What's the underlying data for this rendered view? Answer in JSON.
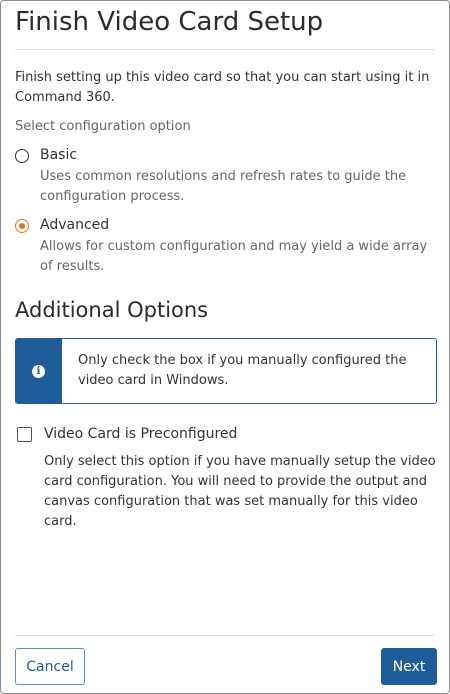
{
  "dialog": {
    "title": "Finish Video Card Setup",
    "intro": "Finish setting up this video card so that you can start using it in Command 360.",
    "config_label": "Select configuration option",
    "options": [
      {
        "label": "Basic",
        "description": "Uses common resolutions and refresh rates to guide the configuration process.",
        "selected": false
      },
      {
        "label": "Advanced",
        "description": "Allows for custom configuration and may yield a wide array of results.",
        "selected": true
      }
    ],
    "additional_heading": "Additional Options",
    "info_icon": "info-icon",
    "info_text": "Only check the box if you manually configured the video card in Windows.",
    "preconfigured": {
      "label": "Video Card is Preconfigured",
      "checked": false,
      "description": "Only select this option if you have manually setup the video card configuration. You will need to provide the output and canvas configuration that was set manually for this video card."
    },
    "buttons": {
      "cancel": "Cancel",
      "next": "Next"
    },
    "colors": {
      "accent": "#1f5c99",
      "radio_selected": "#e8731a"
    }
  }
}
